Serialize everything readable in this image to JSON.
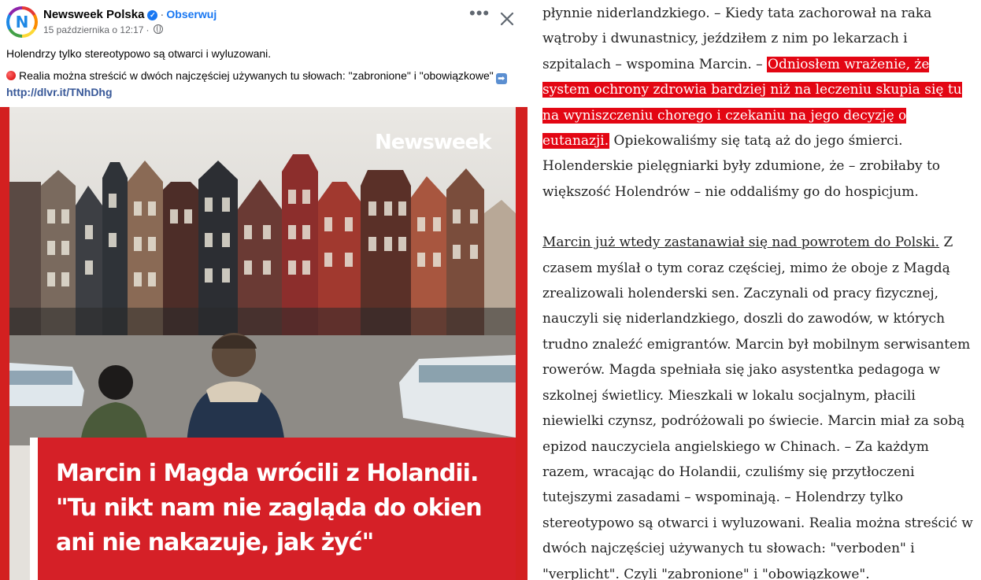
{
  "post": {
    "page_name": "Newsweek Polska",
    "follow_label": "Obserwuj",
    "date": "15 października o 12:17",
    "separator": "·",
    "more_label": "•••",
    "line1": "Holendrzy tylko stereotypowo są otwarci i wyluzowani.",
    "line2_text": "Realia można streścić w dwóch najczęściej używanych tu słowach: \"zabronione\" i \"obowiązkowe\"",
    "link": "http://dlvr.it/TNhDhg",
    "arrow_glyph": "➡"
  },
  "image": {
    "brand": "Newsweek",
    "headline_line1": "Marcin i Magda wrócili z Holandii.",
    "headline_line2": "\"Tu nikt nam nie zagląda do okien",
    "headline_line3": "ani nie nakazuje, jak żyć\""
  },
  "article": {
    "p1_pre": "płynnie niderlandzkiego. – Kiedy tata zachorował na raka wątroby i dwunastnicy, jeździłem z nim po lekarzach i szpitalach – wspomina Marcin. – ",
    "p1_highlight": "Odniosłem wrażenie, że system ochrony zdrowia bardziej niż na leczeniu skupia się tu na wyniszczeniu chorego i czekaniu na jego decyzję o eutanazji.",
    "p1_post": " Opiekowaliśmy się tatą aż do jego śmierci. Holenderskie pielęgniarki były zdumione, że – zrobiłaby to większość Holendrów – nie oddaliśmy go do hospicjum.",
    "p2_underlined": "Marcin już wtedy zastanawiał się nad powrotem do Polski.",
    "p2_rest": " Z czasem myślał o tym coraz częściej, mimo że oboje z Magdą zrealizowali holenderski sen. Zaczynali od pracy fizycznej, nauczyli się niderlandzkiego, doszli do zawodów, w których trudno znaleźć emigrantów. Marcin był mobilnym serwisantem rowerów. Magda spełniała się jako asystentka pedagoga w szkolnej świetlicy. Mieszkali w lokalu socjalnym, płacili niewielki czynsz, podróżowali po świecie. Marcin miał za sobą epizod nauczyciela angielskiego w Chinach. – Za każdym razem, wracając do Holandii, czuliśmy się przytłoczeni tutejszymi zasadami – wspominają. – Holendrzy tylko stereotypowo są otwarci i wyluzowani. Realia można streścić w dwóch najczęściej używanych tu słowach: \"verboden\" i \"verplicht\". Czyli \"zabronione\" i \"obowiązkowe\"."
  },
  "colors": {
    "banner_red": "#d52027",
    "highlight_red": "#e30613",
    "link_blue": "#1877f2"
  },
  "icons": [
    "newsweek-avatar-icon",
    "verified-badge-icon",
    "globe-icon",
    "more-icon",
    "close-icon",
    "red-circle-icon",
    "right-arrow-icon"
  ]
}
